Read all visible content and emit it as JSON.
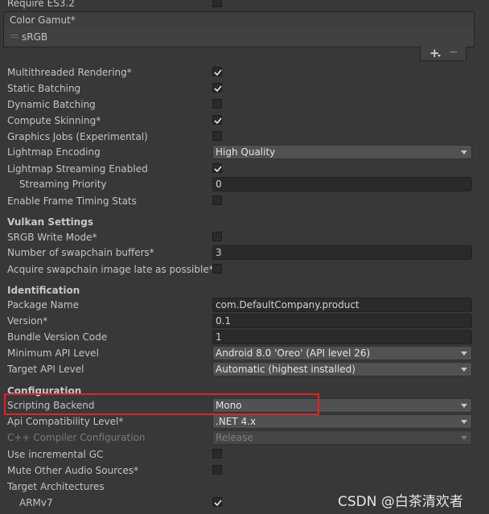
{
  "top": {
    "require_es32_label": "Require ES3.2"
  },
  "color_gamut": {
    "header": "Color Gamut*",
    "items": [
      "sRGB"
    ],
    "add_label": "+",
    "remove_label": "−"
  },
  "rendering": {
    "multithreaded_rendering": {
      "label": "Multithreaded Rendering*",
      "checked": true
    },
    "static_batching": {
      "label": "Static Batching",
      "checked": true
    },
    "dynamic_batching": {
      "label": "Dynamic Batching",
      "checked": false
    },
    "compute_skinning": {
      "label": "Compute Skinning*",
      "checked": true
    },
    "graphics_jobs": {
      "label": "Graphics Jobs (Experimental)",
      "checked": false
    },
    "lightmap_encoding": {
      "label": "Lightmap Encoding",
      "value": "High Quality"
    },
    "lightmap_streaming": {
      "label": "Lightmap Streaming Enabled",
      "checked": true
    },
    "streaming_priority": {
      "label": "Streaming Priority",
      "value": "0"
    },
    "frame_timing_stats": {
      "label": "Enable Frame Timing Stats",
      "checked": false
    }
  },
  "vulkan": {
    "header": "Vulkan Settings",
    "srgb_write_mode": {
      "label": "SRGB Write Mode*",
      "checked": false
    },
    "swapchain_buffers": {
      "label": "Number of swapchain buffers*",
      "value": "3"
    },
    "acquire_late": {
      "label": "Acquire swapchain image late as possible*",
      "checked": false
    }
  },
  "identification": {
    "header": "Identification",
    "package_name": {
      "label": "Package Name",
      "value": "com.DefaultCompany.product"
    },
    "version": {
      "label": "Version*",
      "value": "0.1"
    },
    "bundle_version_code": {
      "label": "Bundle Version Code",
      "value": "1"
    },
    "min_api_level": {
      "label": "Minimum API Level",
      "value": "Android 8.0 'Oreo' (API level 26)"
    },
    "target_api_level": {
      "label": "Target API Level",
      "value": "Automatic (highest installed)"
    }
  },
  "configuration": {
    "header": "Configuration",
    "scripting_backend": {
      "label": "Scripting Backend",
      "value": "Mono"
    },
    "api_compat": {
      "label": "Api Compatibility Level*",
      "value": ".NET 4.x"
    },
    "cpp_compiler": {
      "label": "C++ Compiler Configuration",
      "value": "Release"
    },
    "incremental_gc": {
      "label": "Use incremental GC",
      "checked": false
    },
    "mute_audio": {
      "label": "Mute Other Audio Sources*",
      "checked": false
    },
    "target_arch": {
      "label": "Target Architectures"
    },
    "armv7": {
      "label": "ARMv7",
      "checked": true
    }
  },
  "watermark": "CSDN @白茶清欢者",
  "colors": {
    "highlight_box": "#d8262b",
    "background": "#383838"
  }
}
